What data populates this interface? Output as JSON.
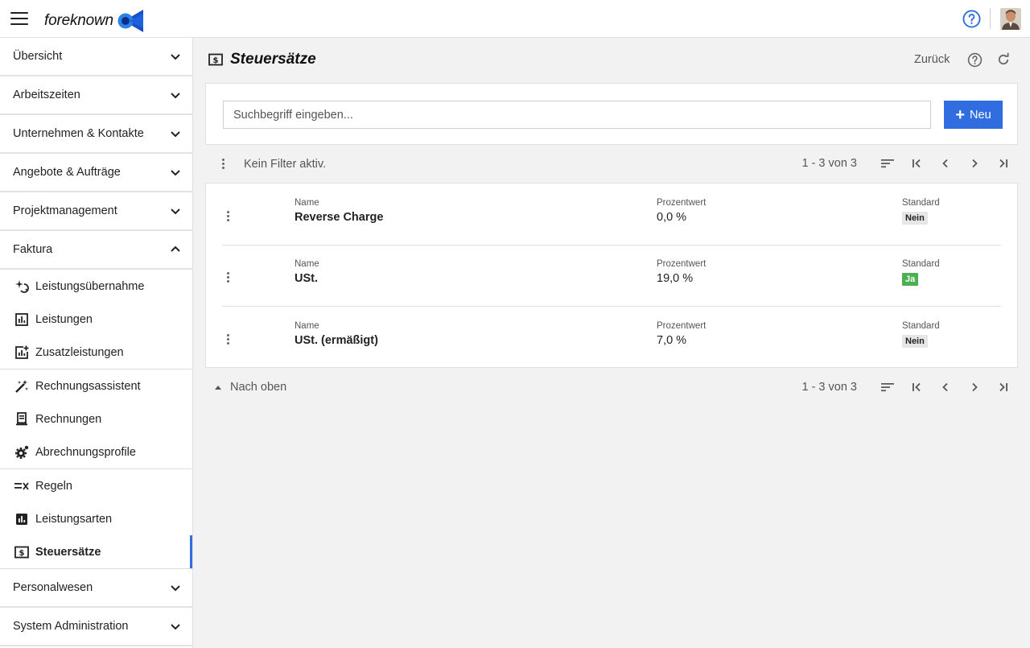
{
  "app": {
    "logo_text": "foreknown",
    "colors": {
      "accent": "#2f6de0",
      "success": "#4caf50"
    }
  },
  "sidebar": {
    "sections_top": [
      {
        "label": "Übersicht",
        "chev": "chevron-down-icon"
      },
      {
        "label": "Arbeitszeiten",
        "chev": "chevron-down-icon"
      },
      {
        "label": "Unternehmen & Kontakte",
        "chev": "chevron-down-icon"
      },
      {
        "label": "Angebote & Aufträge",
        "chev": "chevron-down-icon"
      },
      {
        "label": "Projektmanagement",
        "chev": "chevron-down-icon"
      },
      {
        "label": "Faktura",
        "chev": "chevron-up-icon"
      }
    ],
    "faktura_items": [
      {
        "label": "Leistungsübernahme",
        "icon": "sparkle-icon"
      },
      {
        "label": "Leistungen",
        "icon": "bar-chart-icon"
      },
      {
        "label": "Zusatzleistungen",
        "icon": "add-chart-icon"
      },
      {
        "label": "Rechnungsassistent",
        "icon": "magic-wand-icon"
      },
      {
        "label": "Rechnungen",
        "icon": "receipt-icon"
      },
      {
        "label": "Abrechnungsprofile",
        "icon": "settings-gear-icon"
      },
      {
        "label": "Regeln",
        "icon": "rules-icon"
      },
      {
        "label": "Leistungsarten",
        "icon": "bar-chart-filled-icon"
      },
      {
        "label": "Steuersätze",
        "icon": "currency-icon"
      }
    ],
    "sections_bottom": [
      {
        "label": "Personalwesen",
        "chev": "chevron-down-icon"
      },
      {
        "label": "System Administration",
        "chev": "chevron-down-icon"
      }
    ]
  },
  "main": {
    "title": "Steuersätze",
    "back_label": "Zurück",
    "search_placeholder": "Suchbegriff eingeben...",
    "new_label": "Neu",
    "filter_text": "Kein Filter aktiv.",
    "pager_text": "1 - 3 von 3",
    "to_top_label": "Nach oben",
    "columns": {
      "name": "Name",
      "percent": "Prozentwert",
      "default": "Standard"
    },
    "rows": [
      {
        "name": "Reverse Charge",
        "percent": "0,0 %",
        "default": "Nein",
        "is_default": false
      },
      {
        "name": "USt.",
        "percent": "19,0 %",
        "default": "Ja",
        "is_default": true
      },
      {
        "name": "USt. (ermäßigt)",
        "percent": "7,0 %",
        "default": "Nein",
        "is_default": false
      }
    ]
  }
}
